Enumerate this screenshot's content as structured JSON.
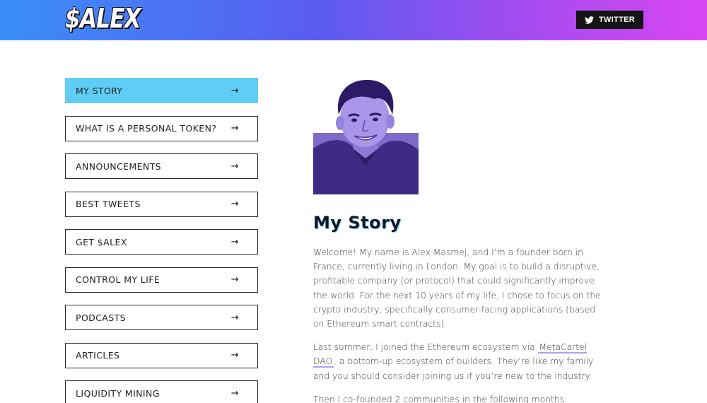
{
  "header": {
    "logo_text": "$ALEX",
    "twitter_label": "TWITTER"
  },
  "nav": {
    "items": [
      {
        "label": "MY STORY",
        "active": true
      },
      {
        "label": "WHAT IS A PERSONAL TOKEN?",
        "active": false
      },
      {
        "label": "ANNOUNCEMENTS",
        "active": false
      },
      {
        "label": "BEST TWEETS",
        "active": false
      },
      {
        "label": "GET $ALEX",
        "active": false
      },
      {
        "label": "CONTROL MY LIFE",
        "active": false
      },
      {
        "label": "PODCASTS",
        "active": false
      },
      {
        "label": "ARTICLES",
        "active": false
      },
      {
        "label": "LIQUIDITY MINING",
        "active": false
      }
    ],
    "arrow_glyph": "→",
    "active_color": "#5fcdf6"
  },
  "main": {
    "title": "My Story",
    "paragraph1": "Welcome! My name is Alex Masmej, and I’m a founder born in France, currently living in London. My goal is to build a disruptive, profitable company (or protocol) that could significantly improve the world. For the next 10 years of my life, I chose to focus on the crypto industry, specifically consumer-facing applications (based on Ethereum smart contracts).",
    "paragraph2_before": "Last summer, I joined the Ethereum ecosystem via ",
    "paragraph2_link": "MetaCartel DAO",
    "paragraph2_after": ", a bottom-up ecosystem of builders. They’re like my family and you should consider joining us if you’re new to the industry.",
    "paragraph3": "Then I co-founded 2 communities in the following months:"
  },
  "colors": {
    "gradient_start": "#3a8ef8",
    "gradient_end": "#d846f2",
    "portrait_tint": "#5b3fa8"
  }
}
